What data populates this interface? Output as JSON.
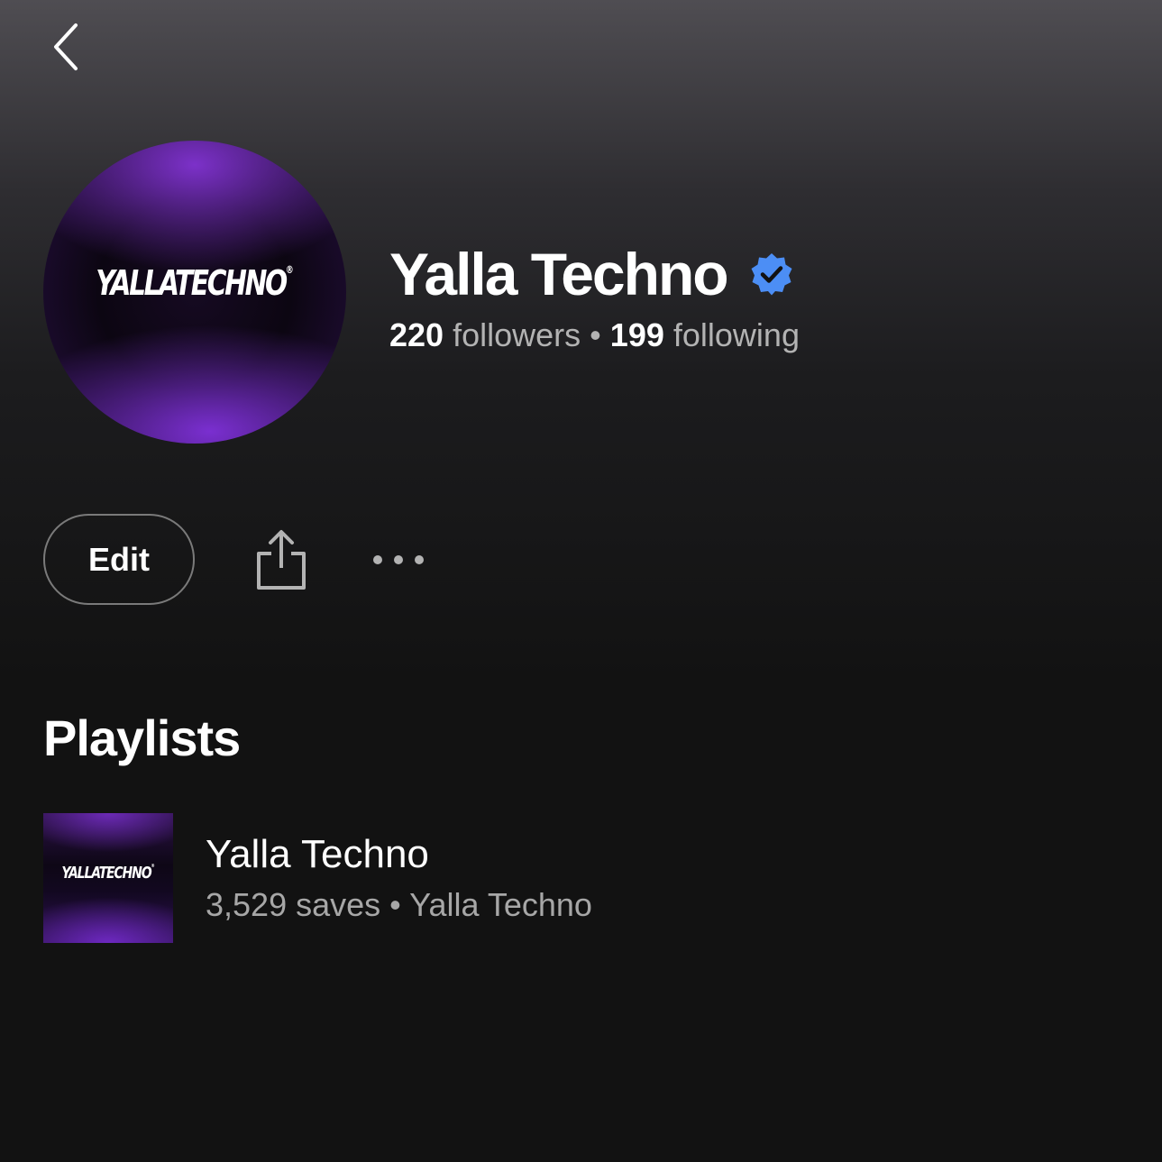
{
  "header": {
    "back_icon": "chevron-left-icon"
  },
  "profile": {
    "avatar_logo": "YALLATECHNO",
    "avatar_logo_mark": "®",
    "name": "Yalla Techno",
    "verified_icon": "verified-badge-icon",
    "verified_color": "#4c8ef5",
    "followers_count": "220",
    "followers_label": "followers",
    "separator": "•",
    "following_count": "199",
    "following_label": "following"
  },
  "actions": {
    "edit_label": "Edit",
    "share_icon": "share-icon",
    "more_icon": "more-horizontal-icon"
  },
  "playlists_section": {
    "title": "Playlists",
    "items": [
      {
        "thumbnail_logo": "YALLATECHNO",
        "thumbnail_logo_mark": "®",
        "title": "Yalla Techno",
        "saves": "3,529 saves",
        "separator": "•",
        "owner": "Yalla Techno"
      }
    ]
  },
  "colors": {
    "background": "#121212",
    "header_gradient_top": "#4f4d52",
    "text_primary": "#ffffff",
    "text_secondary": "#b3b3b3",
    "accent_purple": "#7c31c9"
  }
}
